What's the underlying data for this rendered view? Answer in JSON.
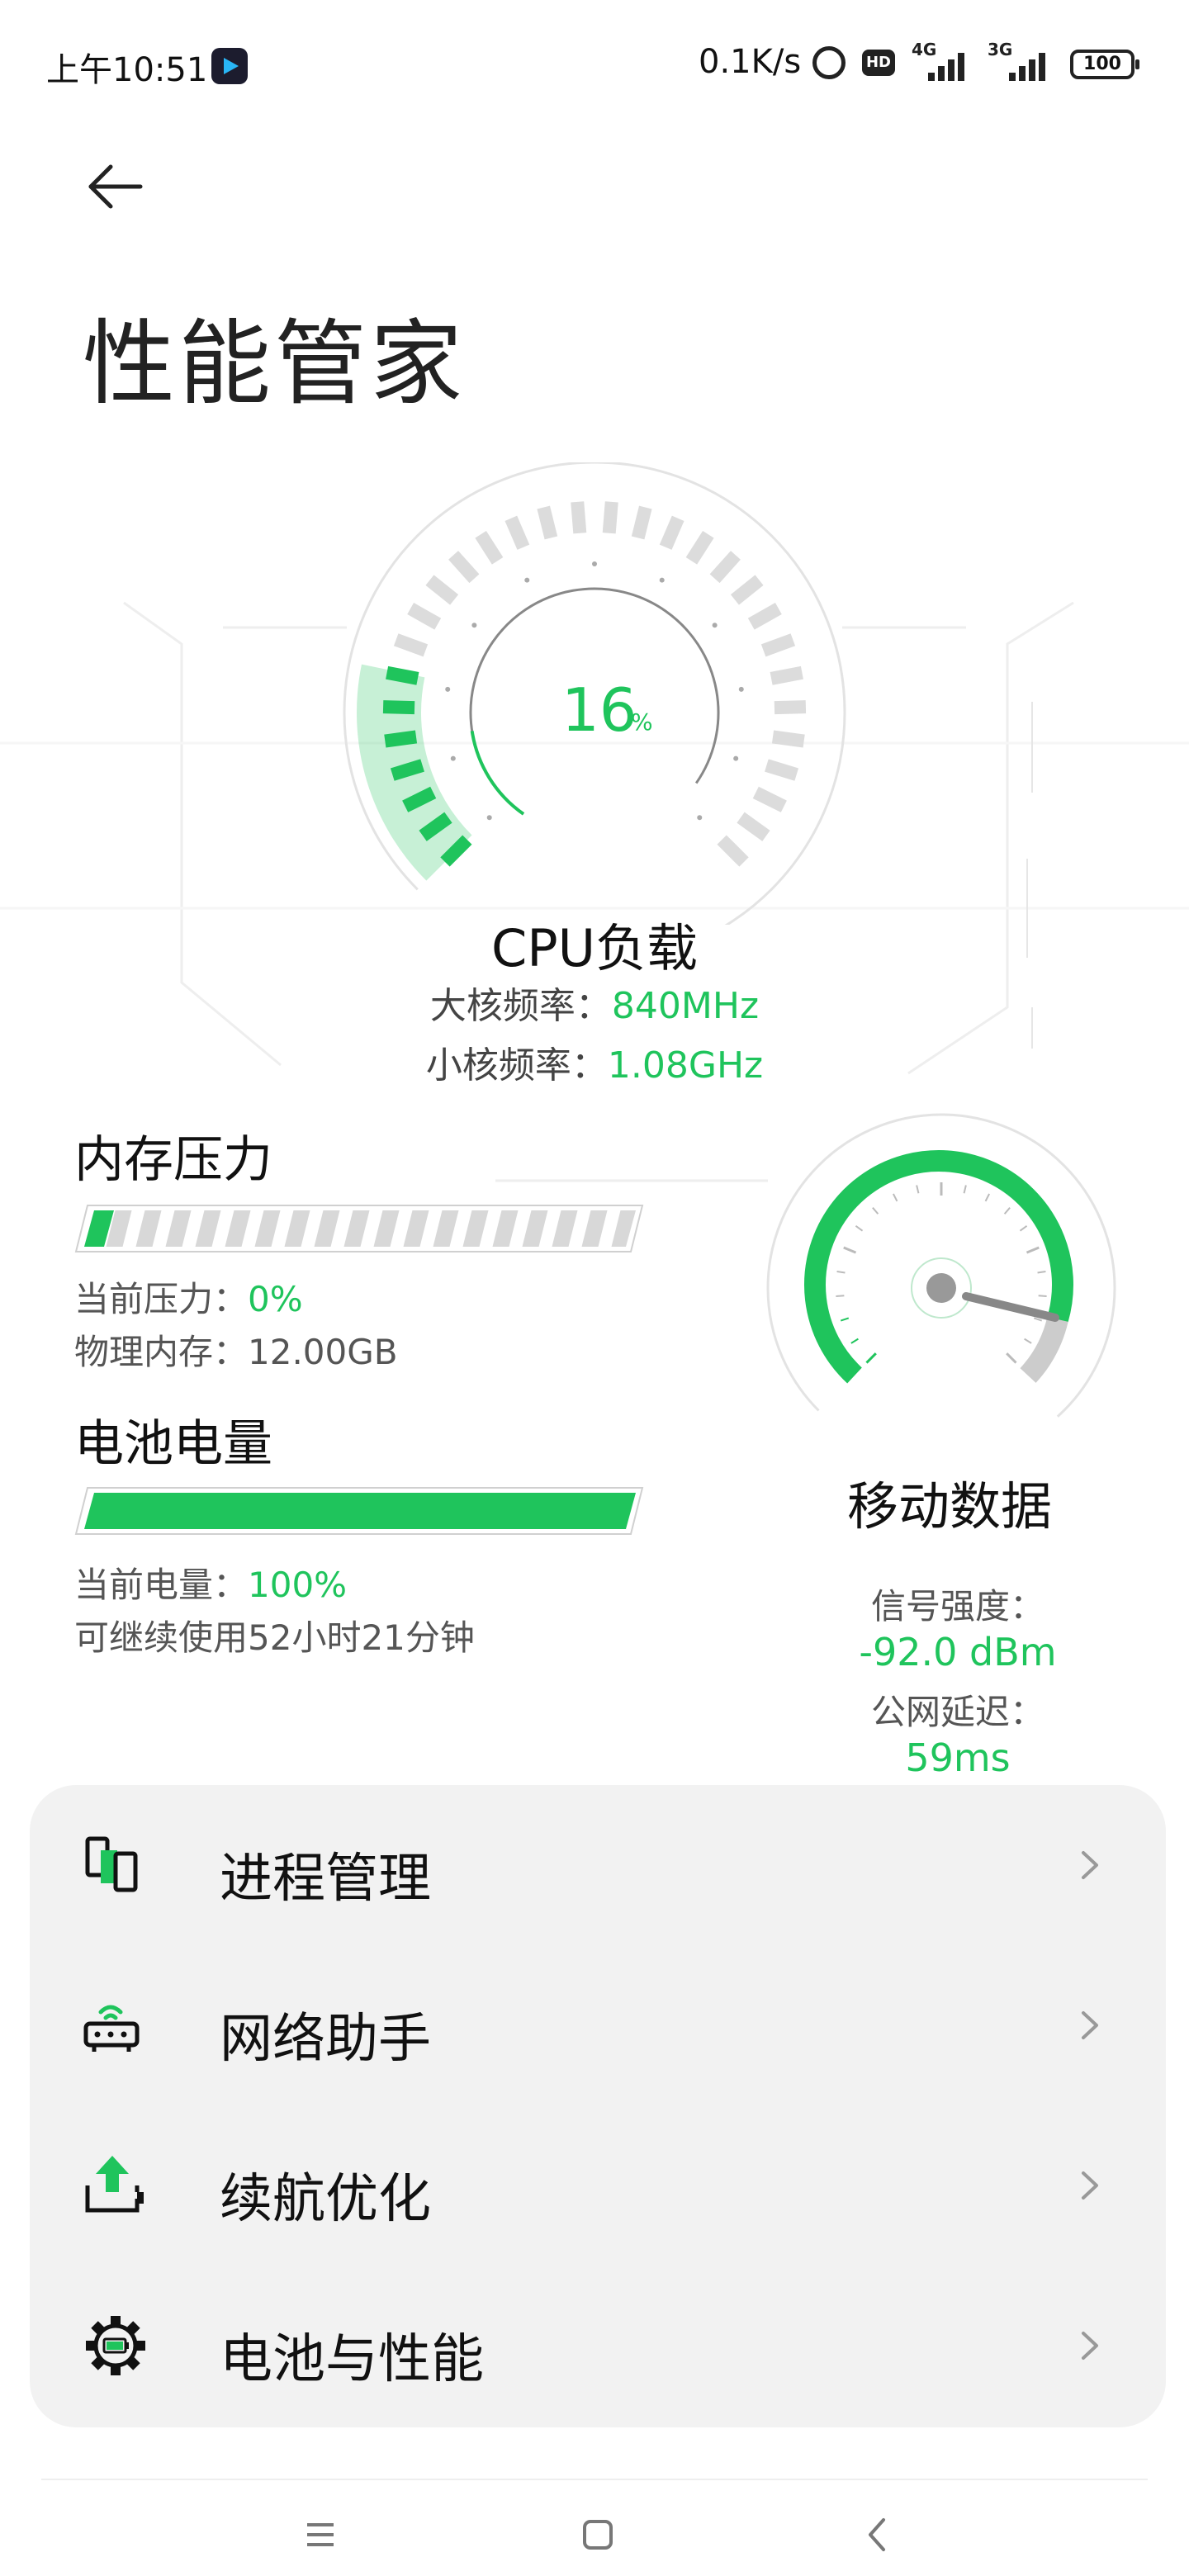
{
  "status_bar": {
    "time": "上午10:51",
    "net_speed": "0.1K/s",
    "hd": "HD",
    "net_type_1": "4G",
    "net_type_2": "3G",
    "battery": "100",
    "icons": [
      "app-icon",
      "alarm-icon",
      "hd-icon",
      "signal-icon",
      "signal-icon",
      "battery-icon"
    ]
  },
  "header": {
    "back_icon": "arrow-left-icon",
    "title": "性能管家"
  },
  "cpu": {
    "value": "16",
    "unit": "%",
    "load_fraction": 0.16,
    "label": "CPU负载",
    "big_core_label": "大核频率：",
    "big_core_value": "840MHz",
    "small_core_label": "小核频率：",
    "small_core_value": "1.08GHz"
  },
  "memory": {
    "title": "内存压力",
    "pressure_label": "当前压力：",
    "pressure_value": "0%",
    "pressure_fraction": 0.0,
    "physical_label": "物理内存：",
    "physical_value": "12.00GB"
  },
  "battery": {
    "title": "电池电量",
    "level_label": "当前电量：",
    "level_value": "100%",
    "level_fraction": 1.0,
    "remaining": "可继续使用52小时21分钟"
  },
  "mobile_data": {
    "title": "移动数据",
    "signal_label": "信号强度：",
    "signal_value": "-92.0 dBm",
    "latency_label": "公网延迟：",
    "latency_value": "59ms"
  },
  "menu": {
    "items": [
      {
        "label": "进程管理",
        "icon": "process-icon"
      },
      {
        "label": "网络助手",
        "icon": "router-icon"
      },
      {
        "label": "续航优化",
        "icon": "battery-boost-icon"
      },
      {
        "label": "电池与性能",
        "icon": "battery-gear-icon"
      }
    ],
    "chevron_icon": "chevron-right-icon"
  },
  "nav_bar": {
    "icons": [
      "menu-icon",
      "home-icon",
      "back-icon"
    ]
  },
  "colors": {
    "accent": "#1fc45c",
    "card_bg": "#f2f2f2",
    "text": "#111111",
    "secondary_text": "#555555"
  }
}
